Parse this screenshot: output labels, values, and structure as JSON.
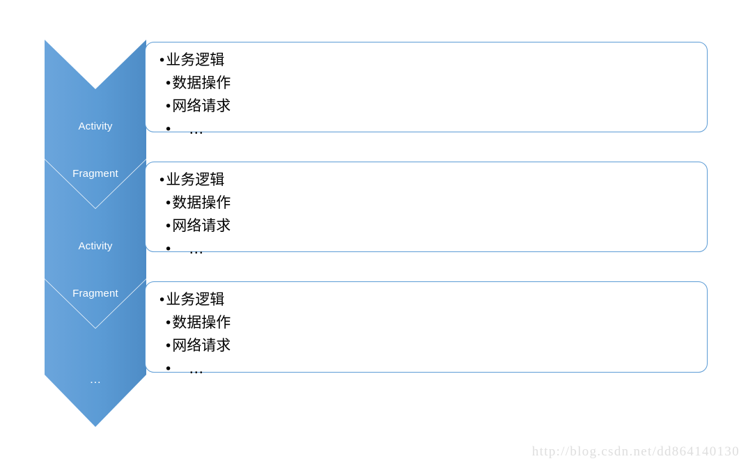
{
  "diagram": {
    "title": "Activity/Fragment responsibilities stack",
    "colors": {
      "arrow_fill": "#5B9BD5",
      "arrow_fill_dark": "#4E8CC6",
      "box_border": "#5B9BD5",
      "box_background": "#FFFFFF",
      "arrow_label_text": "#FFFFFF",
      "bullet_text": "#000000",
      "watermark_text": "#DEDEDE"
    },
    "rows": [
      {
        "arrow": {
          "name": "chevron-arrow-1",
          "lines": [
            "Activity",
            "Fragment"
          ]
        },
        "box": {
          "name": "responsibility-box-1",
          "bullets": [
            {
              "level": 0,
              "marker": "•",
              "text": "业务逻辑"
            },
            {
              "level": 1,
              "marker": "•",
              "text": "数据操作"
            },
            {
              "level": 1,
              "marker": "•",
              "text": "网络请求"
            },
            {
              "level": 2,
              "marker": "•",
              "text": "…"
            }
          ]
        }
      },
      {
        "arrow": {
          "name": "chevron-arrow-2",
          "lines": [
            "Activity",
            "Fragment"
          ]
        },
        "box": {
          "name": "responsibility-box-2",
          "bullets": [
            {
              "level": 0,
              "marker": "•",
              "text": "业务逻辑"
            },
            {
              "level": 1,
              "marker": "•",
              "text": "数据操作"
            },
            {
              "level": 1,
              "marker": "•",
              "text": "网络请求"
            },
            {
              "level": 2,
              "marker": "•",
              "text": "…"
            }
          ]
        }
      },
      {
        "arrow": {
          "name": "chevron-arrow-3",
          "lines": [
            "…"
          ]
        },
        "box": {
          "name": "responsibility-box-3",
          "bullets": [
            {
              "level": 0,
              "marker": "•",
              "text": "业务逻辑"
            },
            {
              "level": 1,
              "marker": "•",
              "text": "数据操作"
            },
            {
              "level": 1,
              "marker": "•",
              "text": "网络请求"
            },
            {
              "level": 2,
              "marker": "•",
              "text": "…"
            }
          ]
        }
      }
    ]
  },
  "watermark": {
    "text": "http://blog.csdn.net/dd864140130"
  }
}
